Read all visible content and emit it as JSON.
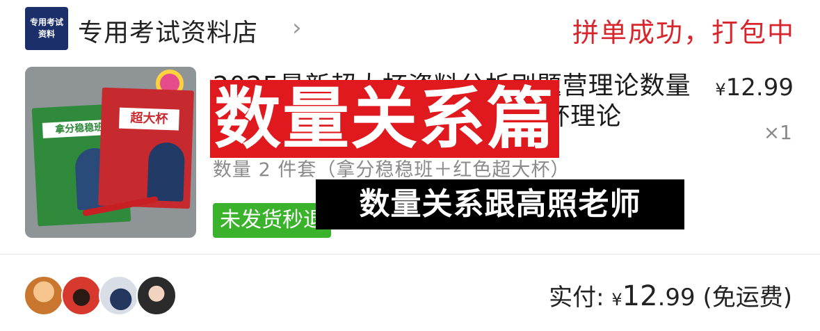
{
  "shop": {
    "logo_line1": "专用考试",
    "logo_line2": "资料",
    "name": "专用考试资料店",
    "chevron_glyph": "›"
  },
  "order": {
    "status": "拼单成功，打包中",
    "status_color": "#d8242b"
  },
  "product": {
    "image_book_green_title": "拿分稳稳班",
    "image_book_red_title": "超大杯",
    "title": "2025最新超大杯资料分析刷题营理论数量2件套(拿分稳稳班+红色超大杯理论",
    "variant": "数量 2 件套（拿分稳稳班＋红色超大杯）",
    "price_currency": "¥",
    "price": "12.99",
    "quantity": "×1",
    "badge": "未发货秒退",
    "badge_color": "#3bb22c"
  },
  "overlay": {
    "headline": "数量关系篇",
    "caption": "数量关系跟高照老师"
  },
  "footer": {
    "avatar_icons": [
      "avatar-1",
      "avatar-2",
      "avatar-3",
      "avatar-4"
    ],
    "total_label": "实付: ",
    "total_currency": "¥",
    "total_int": "12",
    "total_dec": ".99",
    "shipping": " (免运费)"
  }
}
